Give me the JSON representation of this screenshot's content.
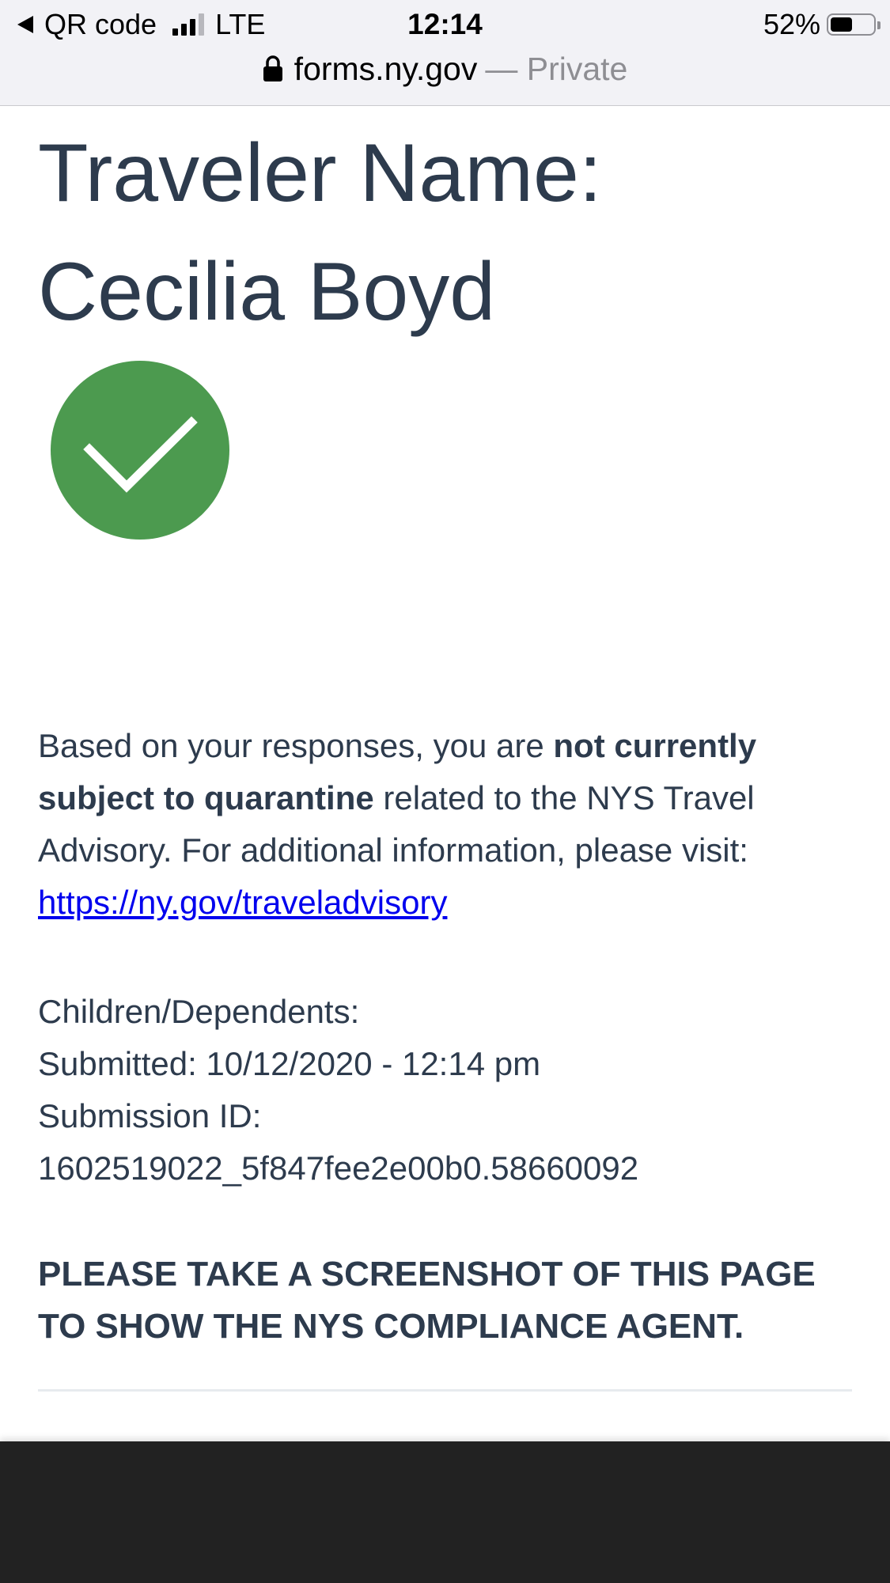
{
  "status_bar": {
    "back_app": "QR code",
    "network": "LTE",
    "time": "12:14",
    "battery_percent_label": "52%",
    "battery_level": 0.52
  },
  "browser": {
    "domain": "forms.ny.gov",
    "private_label": "— Private"
  },
  "page": {
    "title_line1": "Traveler Name:",
    "title_line2": "Cecilia Boyd",
    "status_icon": "checkmark-circle-icon",
    "status_color": "#4c9a4f",
    "message": {
      "intro": "Based on your responses, you are ",
      "emphasis": "not currently subject to quarantine",
      "middle": " related to the NYS Travel Advisory. For additional information, please visit: ",
      "link_text": "https://ny.gov/traveladvisory"
    },
    "details": {
      "children_label": "Children/Dependents:",
      "submitted": "Submitted: 10/12/2020 - 12:14 pm",
      "submission_id_label": "Submission ID:",
      "submission_id_value": "1602519022_5f847fee2e00b0.58660092"
    },
    "notice": "PLEASE TAKE A SCREENSHOT OF THIS PAGE TO SHOW THE NYS COMPLIANCE AGENT."
  },
  "colors": {
    "text": "#2d3b4d",
    "link": "#0000ee",
    "bottom_bar": "#222222"
  }
}
